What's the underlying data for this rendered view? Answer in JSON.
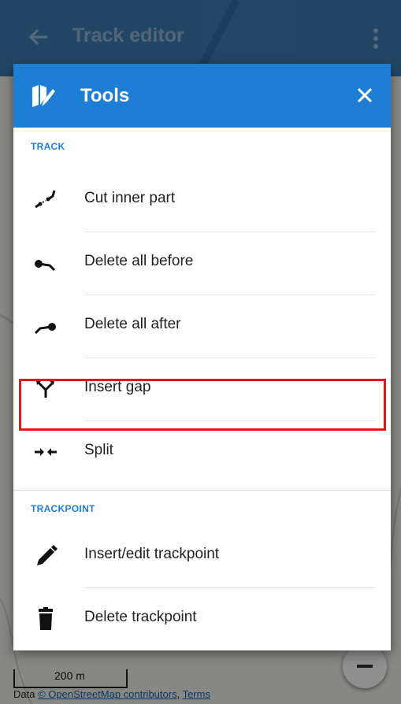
{
  "appbar": {
    "title": "Track editor",
    "back_icon": "arrow-left-icon",
    "menu_icon": "more-vert-icon"
  },
  "dialog": {
    "title": "Tools",
    "title_icon": "track-tools-icon",
    "close_icon": "close-icon",
    "accent_color": "#1e7ed6",
    "sections": [
      {
        "header": "TRACK",
        "items": [
          {
            "label": "Cut inner part",
            "icon": "cut-inner-part-icon"
          },
          {
            "label": "Delete all before",
            "icon": "delete-all-before-icon"
          },
          {
            "label": "Delete all after",
            "icon": "delete-all-after-icon"
          },
          {
            "label": "Insert gap",
            "icon": "insert-gap-icon",
            "highlighted": true
          },
          {
            "label": "Split",
            "icon": "split-icon"
          }
        ]
      },
      {
        "header": "TRACKPOINT",
        "items": [
          {
            "label": "Insert/edit trackpoint",
            "icon": "pencil-icon"
          },
          {
            "label": "Delete trackpoint",
            "icon": "trash-icon"
          }
        ]
      }
    ]
  },
  "map": {
    "scale_label": "200 m",
    "attribution_prefix": "Data ",
    "attribution_link": "© OpenStreetMap contributors",
    "attribution_sep": ", ",
    "attribution_terms": "Terms",
    "zoom_out_icon": "minus-icon"
  },
  "colors": {
    "highlight": "#e21818",
    "appbar": "#1d67a8"
  }
}
